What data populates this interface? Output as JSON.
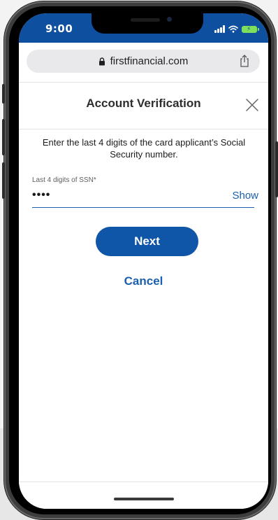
{
  "status_bar": {
    "time": "9:00",
    "icons": [
      "cellular-signal-icon",
      "wifi-icon",
      "battery-charging-icon"
    ],
    "background": "#0e4fa0",
    "battery_color": "#7ee05a"
  },
  "browser": {
    "url": "firstfinancial.com",
    "lock_icon": "lock-icon",
    "share_icon": "share-icon"
  },
  "modal": {
    "title": "Account Verification",
    "close_icon": "close-icon",
    "instruction": "Enter the last 4 digits of the card applicant’s Social Security number.",
    "ssn_field": {
      "label": "Last 4 digits of SSN*",
      "value": "••••",
      "show_label": "Show"
    },
    "next_label": "Next",
    "cancel_label": "Cancel"
  },
  "colors": {
    "primary": "#0f56a8",
    "link": "#1b5fad",
    "text": "#1c1c1c"
  }
}
